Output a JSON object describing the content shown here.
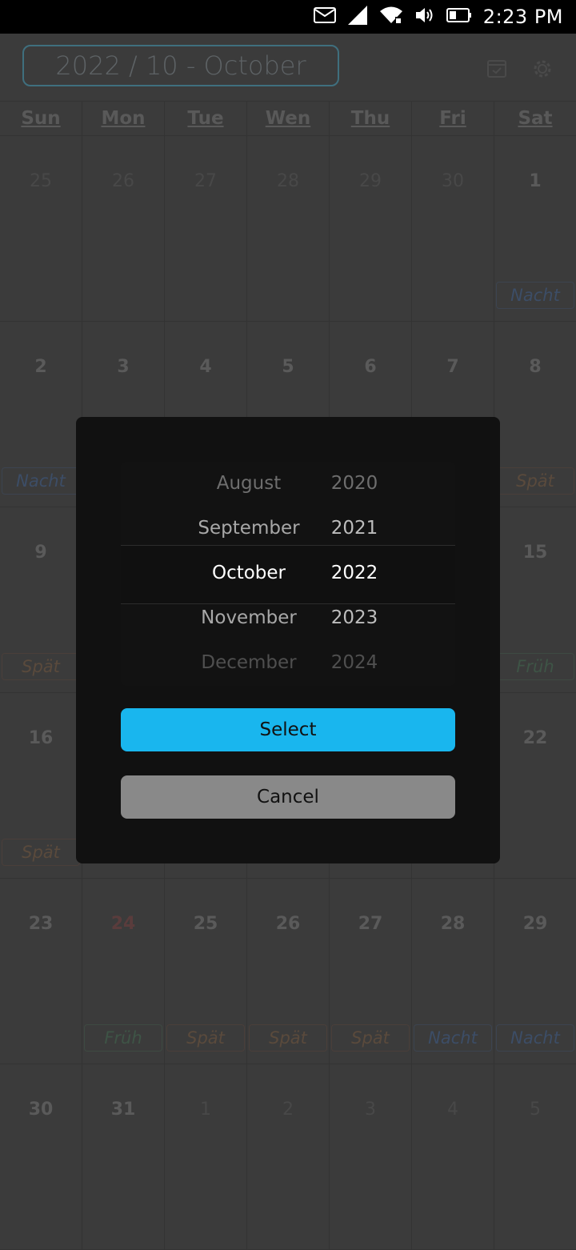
{
  "status_bar": {
    "time": "2:23 PM"
  },
  "header": {
    "title": "2022 / 10 - October"
  },
  "weekdays": [
    "Sun",
    "Mon",
    "Tue",
    "Wen",
    "Thu",
    "Fri",
    "Sat"
  ],
  "weeks": [
    {
      "days": [
        {
          "n": "25",
          "faint": true
        },
        {
          "n": "26",
          "faint": true
        },
        {
          "n": "27",
          "faint": true
        },
        {
          "n": "28",
          "faint": true
        },
        {
          "n": "29",
          "faint": true
        },
        {
          "n": "30",
          "faint": true
        },
        {
          "n": "1",
          "shift": "Nacht",
          "kind": "nacht"
        }
      ]
    },
    {
      "days": [
        {
          "n": "2",
          "shift": "Nacht",
          "kind": "nacht"
        },
        {
          "n": "3"
        },
        {
          "n": "4"
        },
        {
          "n": "5"
        },
        {
          "n": "6"
        },
        {
          "n": "7"
        },
        {
          "n": "8",
          "shift": "Spät",
          "kind": "spaet"
        }
      ]
    },
    {
      "days": [
        {
          "n": "9",
          "shift": "Spät",
          "kind": "spaet"
        },
        {
          "n": ""
        },
        {
          "n": ""
        },
        {
          "n": ""
        },
        {
          "n": ""
        },
        {
          "n": ""
        },
        {
          "n": "15",
          "shift": "Früh",
          "kind": "frueh"
        }
      ]
    },
    {
      "days": [
        {
          "n": "16",
          "shift": "Spät",
          "kind": "spaet"
        },
        {
          "n": ""
        },
        {
          "n": ""
        },
        {
          "n": ""
        },
        {
          "n": ""
        },
        {
          "n": ""
        },
        {
          "n": "22"
        }
      ]
    },
    {
      "days": [
        {
          "n": "23"
        },
        {
          "n": "24",
          "today": true,
          "shift": "Früh",
          "kind": "frueh"
        },
        {
          "n": "25",
          "shift": "Spät",
          "kind": "spaet"
        },
        {
          "n": "26",
          "shift": "Spät",
          "kind": "spaet"
        },
        {
          "n": "27",
          "shift": "Spät",
          "kind": "spaet"
        },
        {
          "n": "28",
          "shift": "Nacht",
          "kind": "nacht"
        },
        {
          "n": "29",
          "shift": "Nacht",
          "kind": "nacht"
        }
      ]
    },
    {
      "days": [
        {
          "n": "30"
        },
        {
          "n": "31"
        },
        {
          "n": "1",
          "faint": true
        },
        {
          "n": "2",
          "faint": true
        },
        {
          "n": "3",
          "faint": true
        },
        {
          "n": "4",
          "faint": true
        },
        {
          "n": "5",
          "faint": true
        }
      ]
    }
  ],
  "dialog": {
    "months": [
      "August",
      "September",
      "October",
      "November",
      "December"
    ],
    "years": [
      "2020",
      "2021",
      "2022",
      "2023",
      "2024"
    ],
    "selected_month": "October",
    "selected_year": "2022",
    "select_label": "Select",
    "cancel_label": "Cancel"
  },
  "colors": {
    "accent": "#19b6ee",
    "cancel": "#898989"
  }
}
